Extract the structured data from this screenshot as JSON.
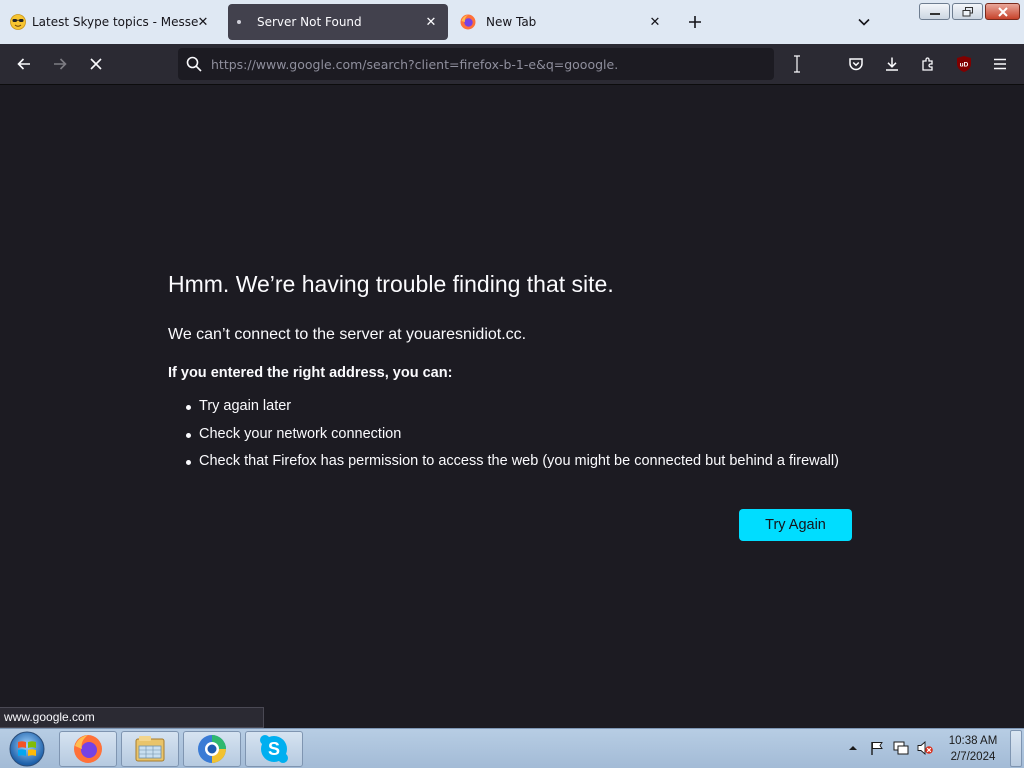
{
  "tabs": [
    {
      "label": "Latest Skype topics - Messenger",
      "favicon": "sunglasses-emoji-icon"
    },
    {
      "label": "Server Not Found",
      "favicon": "loading-dot-icon",
      "active": true
    },
    {
      "label": "New Tab",
      "favicon": "firefox-icon"
    }
  ],
  "toolbar": {
    "url": "https://www.google.com/search?client=firefox-b-1-e&q=gooogle.",
    "nav_icons": [
      "back-arrow-icon",
      "forward-arrow-icon",
      "stop-loading-icon"
    ],
    "right_icons": [
      "pocket-icon",
      "downloads-icon",
      "extensions-icon",
      "ublock-origin-icon",
      "hamburger-menu-icon"
    ]
  },
  "error": {
    "title": "Hmm. We’re having trouble finding that site.",
    "subtitle": "We can’t connect to the server at youaresnidiot.cc.",
    "lead": "If you entered the right address, you can:",
    "items": [
      "Try again later",
      "Check your network connection",
      "Check that Firefox has permission to access the web (you might be connected but behind a firewall)"
    ],
    "button_label": "Try Again"
  },
  "status": {
    "text": "www.google.com"
  },
  "taskbar": {
    "apps": [
      "firefox-icon",
      "file-explorer-icon",
      "browser-app-icon",
      "skype-icon"
    ],
    "time": "10:38 AM",
    "date": "2/7/2024"
  },
  "colors": {
    "page_bg": "#1c1b22",
    "toolbar_bg": "#2b2a33",
    "button_accent": "#00ddff",
    "tab_active_bg": "#42414d"
  }
}
